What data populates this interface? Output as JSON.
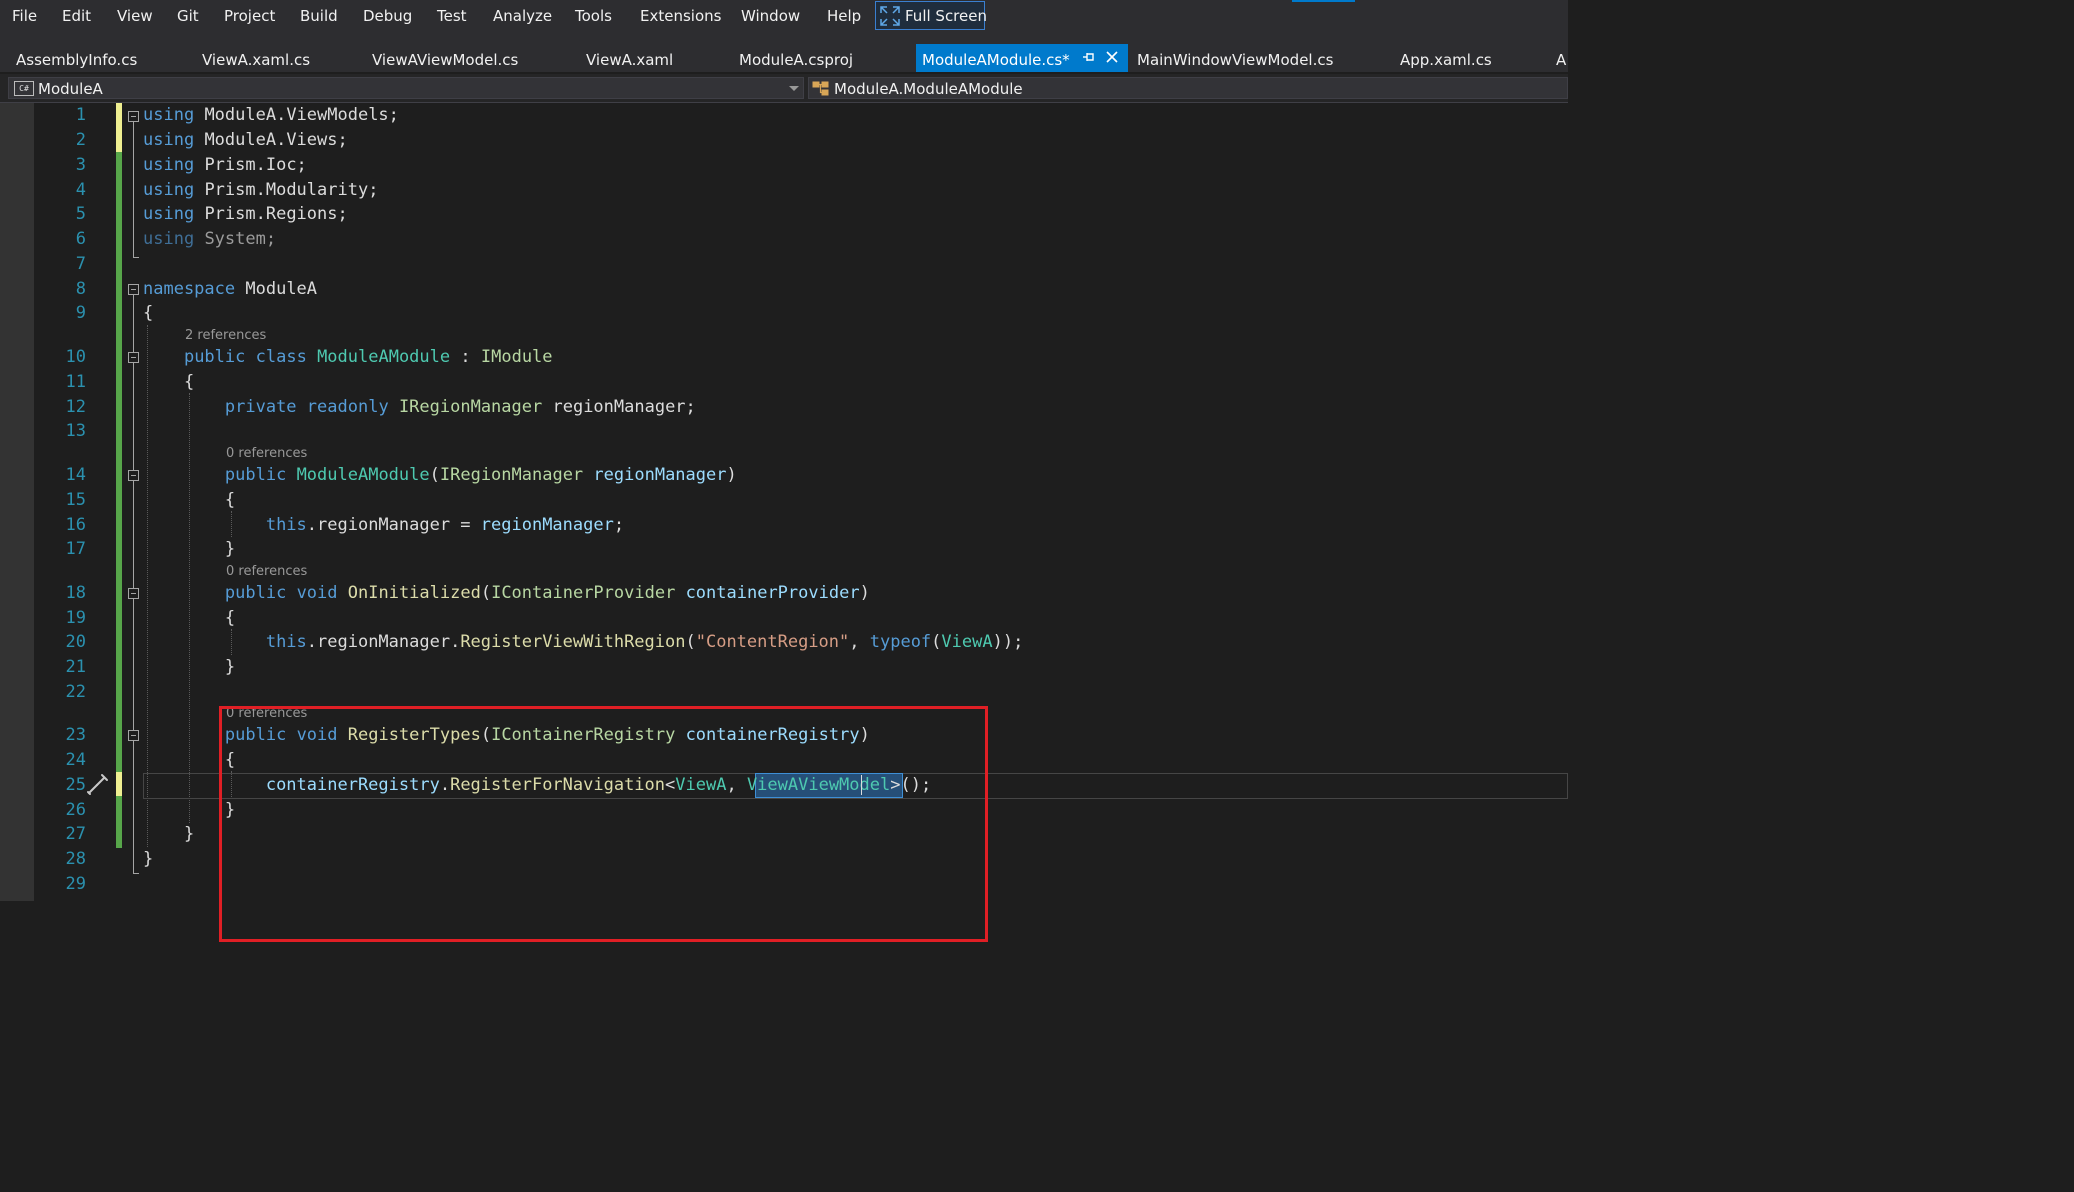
{
  "menu": {
    "file": "File",
    "edit": "Edit",
    "view": "View",
    "git": "Git",
    "project": "Project",
    "build": "Build",
    "debug": "Debug",
    "test": "Test",
    "analyze": "Analyze",
    "tools": "Tools",
    "extensions": "Extensions",
    "window": "Window",
    "help": "Help",
    "full_screen": "Full Screen"
  },
  "tabs": [
    "AssemblyInfo.cs",
    "ViewA.xaml.cs",
    "ViewAViewModel.cs",
    "ViewA.xaml",
    "ModuleA.csproj",
    "ModuleAModule.cs*",
    "MainWindowViewModel.cs",
    "App.xaml.cs",
    "A"
  ],
  "navbar": {
    "project_icon": "C#",
    "project": "ModuleA",
    "class": "ModuleA.ModuleAModule"
  },
  "line_numbers": [
    "1",
    "2",
    "3",
    "4",
    "5",
    "6",
    "7",
    "8",
    "9",
    "10",
    "11",
    "12",
    "13",
    "14",
    "15",
    "16",
    "17",
    "18",
    "19",
    "20",
    "21",
    "22",
    "23",
    "24",
    "25",
    "26",
    "27",
    "28",
    "29"
  ],
  "codelens": {
    "class_refs": "2 references",
    "ctor_refs": "0 references",
    "oninit_refs": "0 references",
    "register_refs": "0 references"
  },
  "code": {
    "l1": [
      "using",
      "ModuleA.ViewModels;"
    ],
    "l2": [
      "using",
      "ModuleA.Views;"
    ],
    "l3": [
      "using",
      "Prism.Ioc;"
    ],
    "l4": [
      "using",
      "Prism.Modularity;"
    ],
    "l5": [
      "using",
      "Prism.Regions;"
    ],
    "l6": [
      "using",
      "System;"
    ],
    "l8": [
      "namespace",
      "ModuleA"
    ],
    "l9": [
      "{"
    ],
    "l10": [
      "public",
      "class",
      "ModuleAModule",
      ":",
      "IModule"
    ],
    "l11": [
      "{"
    ],
    "l12": [
      "private",
      "readonly",
      "IRegionManager",
      "regionManager;"
    ],
    "l14": [
      "public",
      "ModuleAModule",
      "(",
      "IRegionManager",
      "regionManager",
      ")"
    ],
    "l15": [
      "{"
    ],
    "l16": [
      "this",
      ".regionManager = ",
      "regionManager",
      ";"
    ],
    "l17": [
      "}"
    ],
    "l18": [
      "public",
      "void",
      "OnInitialized",
      "(",
      "IContainerProvider",
      "containerProvider",
      ")"
    ],
    "l19": [
      "{"
    ],
    "l20": [
      "this",
      ".regionManager.",
      "RegisterViewWithRegion",
      "(",
      "\"ContentRegion\"",
      ", ",
      "typeof",
      "(",
      "ViewA",
      "));"
    ],
    "l21": [
      "}"
    ],
    "l23": [
      "public",
      "void",
      "RegisterTypes",
      "(",
      "IContainerRegistry",
      "containerRegistry",
      ")"
    ],
    "l24": [
      "{"
    ],
    "l25": [
      "containerRegistry",
      ".",
      "RegisterForNavigation",
      "<",
      "ViewA",
      ", ",
      "ViewAViewModel",
      ">();"
    ],
    "l26": [
      "}"
    ],
    "l27": [
      "}"
    ],
    "l28": [
      "}"
    ]
  },
  "colors": {
    "keyword": "#569cd6",
    "type": "#4ec9b0",
    "interface": "#b8d7a3",
    "method": "#dcdcaa",
    "parameter": "#9cdcfe",
    "string": "#d69d85",
    "line_number": "#2b91af",
    "accent": "#007acc",
    "annotation": "#e01f25"
  },
  "icons": {
    "full_screen": "expand-arrows-icon",
    "pin": "pin-icon",
    "close": "close-icon",
    "class": "class-icon",
    "quick_action": "screwdriver-icon"
  }
}
